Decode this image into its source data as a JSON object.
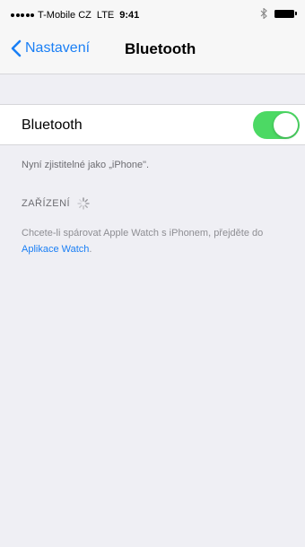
{
  "status_bar": {
    "carrier": "T-Mobile CZ",
    "network": "LTE",
    "time": "9:41",
    "icons": [
      "signal-icon",
      "bluetooth-icon",
      "battery-icon"
    ]
  },
  "nav": {
    "back_label": "Nastavení",
    "title": "Bluetooth"
  },
  "bluetooth_row": {
    "label": "Bluetooth",
    "enabled": true
  },
  "discoverable_text": "Nyní zjistitelné jako „iPhone\".",
  "devices_section": {
    "header": "ZAŘÍZENÍ"
  },
  "info": {
    "text": "Chcete-li spárovat Apple Watch s iPhonem, přejděte do",
    "link": "Aplikace Watch",
    "end": "."
  },
  "colors": {
    "accent": "#1a7ff5",
    "toggle_on": "#4cd964",
    "background": "#efeff4"
  }
}
